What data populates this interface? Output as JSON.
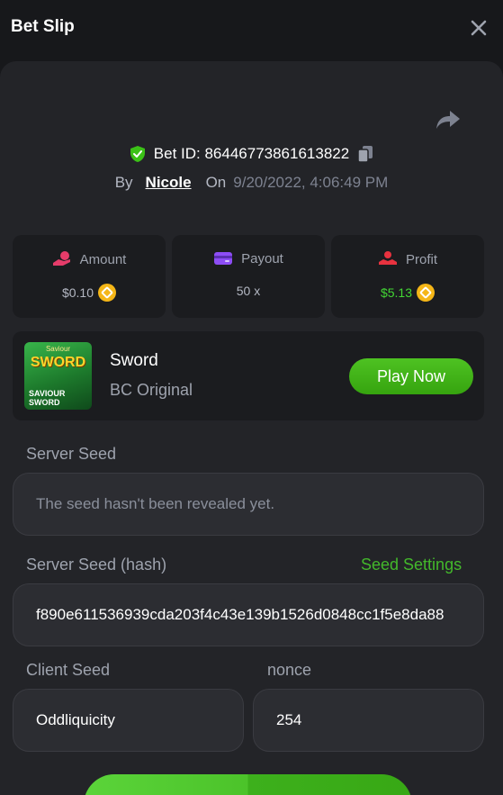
{
  "header": {
    "title": "Bet Slip"
  },
  "bet": {
    "id_text": "Bet ID: 86446773861613822",
    "by_label": "By",
    "user": "Nicole",
    "on_label": "On",
    "date": "9/20/2022, 4:06:49 PM"
  },
  "stats": [
    {
      "label": "Amount",
      "value": "$0.10",
      "icon": "hand-coin-icon",
      "icon_color": "#e63c6a"
    },
    {
      "label": "Payout",
      "value": "50 x",
      "icon": "wallet-icon",
      "icon_color": "#8d4df5"
    },
    {
      "label": "Profit",
      "value": "$5.13",
      "icon": "hand-heart-icon",
      "icon_color": "#e8323f"
    }
  ],
  "game": {
    "thumb_title": "SWORD",
    "thumb_sup": "Saviour",
    "thumb_sub": "SAVIOUR SWORD",
    "name": "Sword",
    "provider": "BC Original",
    "play_label": "Play Now"
  },
  "seeds": {
    "server_seed_label": "Server Seed",
    "server_seed_placeholder": "The seed hasn't been revealed yet.",
    "server_hash_label": "Server Seed (hash)",
    "seed_settings_label": "Seed Settings",
    "server_hash_value": "f890e611536939cda203f4c43e139b1526d0848cc1f5e8da88",
    "client_seed_label": "Client Seed",
    "client_seed_value": "Oddliquicity",
    "nonce_label": "nonce",
    "nonce_value": "254"
  },
  "colors": {
    "accent_green": "#43b82b",
    "profit_green": "#43d634",
    "background": "#17181b",
    "panel": "#232428"
  }
}
